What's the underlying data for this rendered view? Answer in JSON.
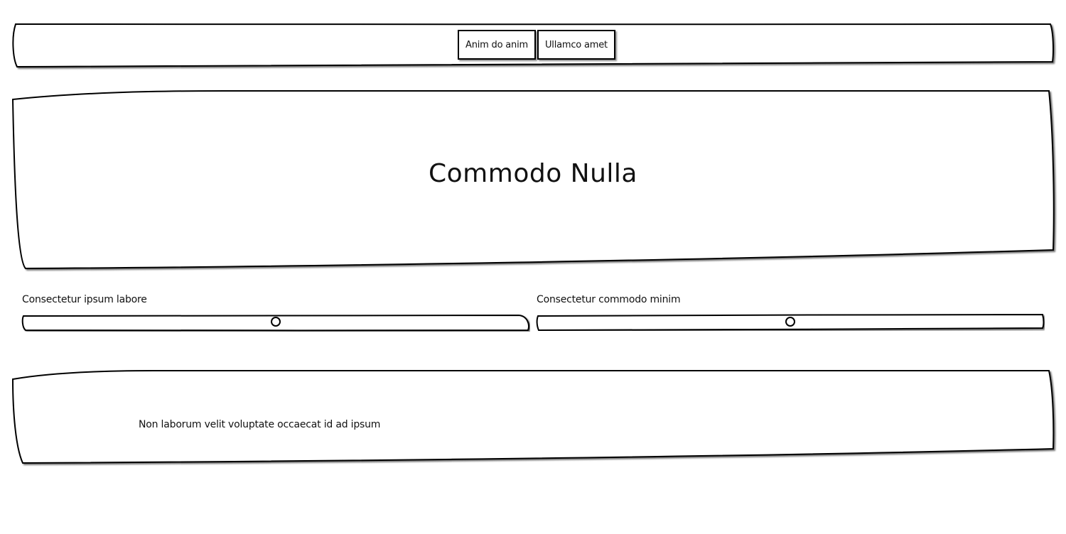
{
  "nav": {
    "buttons": [
      {
        "label": "Anim do anim"
      },
      {
        "label": "Ullamco amet"
      }
    ]
  },
  "hero": {
    "title": "Commodo Nulla"
  },
  "sliders": [
    {
      "label": "Consectetur ipsum labore",
      "value": 0.5
    },
    {
      "label": "Consectetur commodo minim",
      "value": 0.5
    }
  ],
  "panel": {
    "text": "Non laborum velit voluptate occaecat id ad ipsum"
  },
  "colors": {
    "stroke": "#000000",
    "background": "#ffffff"
  }
}
